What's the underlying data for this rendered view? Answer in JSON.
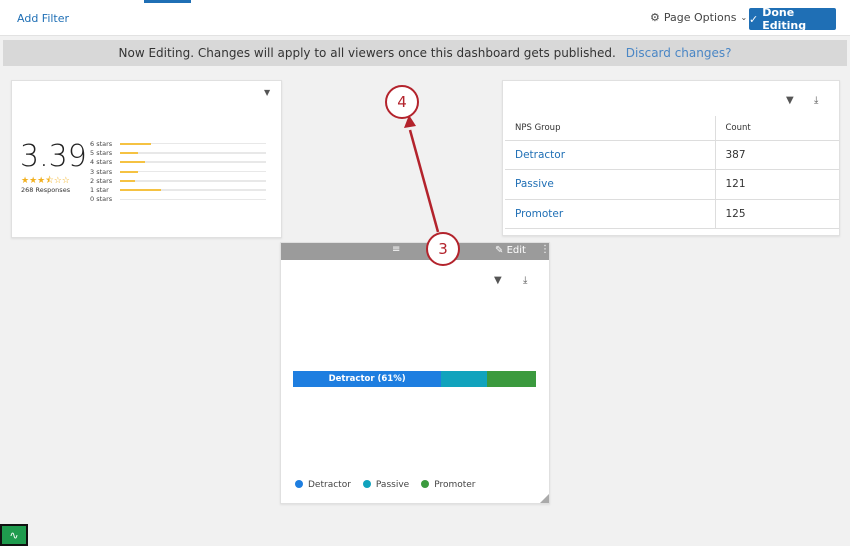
{
  "topbar": {
    "add_filter": "Add Filter",
    "page_options": "Page Options",
    "done_editing": "Done Editing"
  },
  "banner": {
    "message": "Now Editing. Changes will apply to all viewers once this dashboard gets published.",
    "discard": "Discard changes?"
  },
  "rating_widget": {
    "average": "3.39",
    "stars": "★★★⯪☆☆",
    "responses": "268 Responses",
    "distribution": [
      {
        "label": "6 stars",
        "fraction": 0.21
      },
      {
        "label": "5 stars",
        "fraction": 0.12
      },
      {
        "label": "4 stars",
        "fraction": 0.17
      },
      {
        "label": "3 stars",
        "fraction": 0.12
      },
      {
        "label": "2 stars",
        "fraction": 0.1
      },
      {
        "label": "1 star",
        "fraction": 0.28
      },
      {
        "label": "0 stars",
        "fraction": 0
      }
    ]
  },
  "nps_table": {
    "headers": [
      "NPS Group",
      "Count"
    ],
    "rows": [
      [
        "Detractor",
        "387"
      ],
      [
        "Passive",
        "121"
      ],
      [
        "Promoter",
        "125"
      ]
    ]
  },
  "bar_widget": {
    "edit": "Edit",
    "bar_label": "Detractor (61%)",
    "segments": [
      {
        "name": "Detractor",
        "percent": 61,
        "color": "#1e7ee0"
      },
      {
        "name": "Passive",
        "percent": 19,
        "color": "#11a3bd"
      },
      {
        "name": "Promoter",
        "percent": 20,
        "color": "#3b9a3e"
      }
    ]
  },
  "callouts": {
    "first": "3",
    "second": "4"
  }
}
